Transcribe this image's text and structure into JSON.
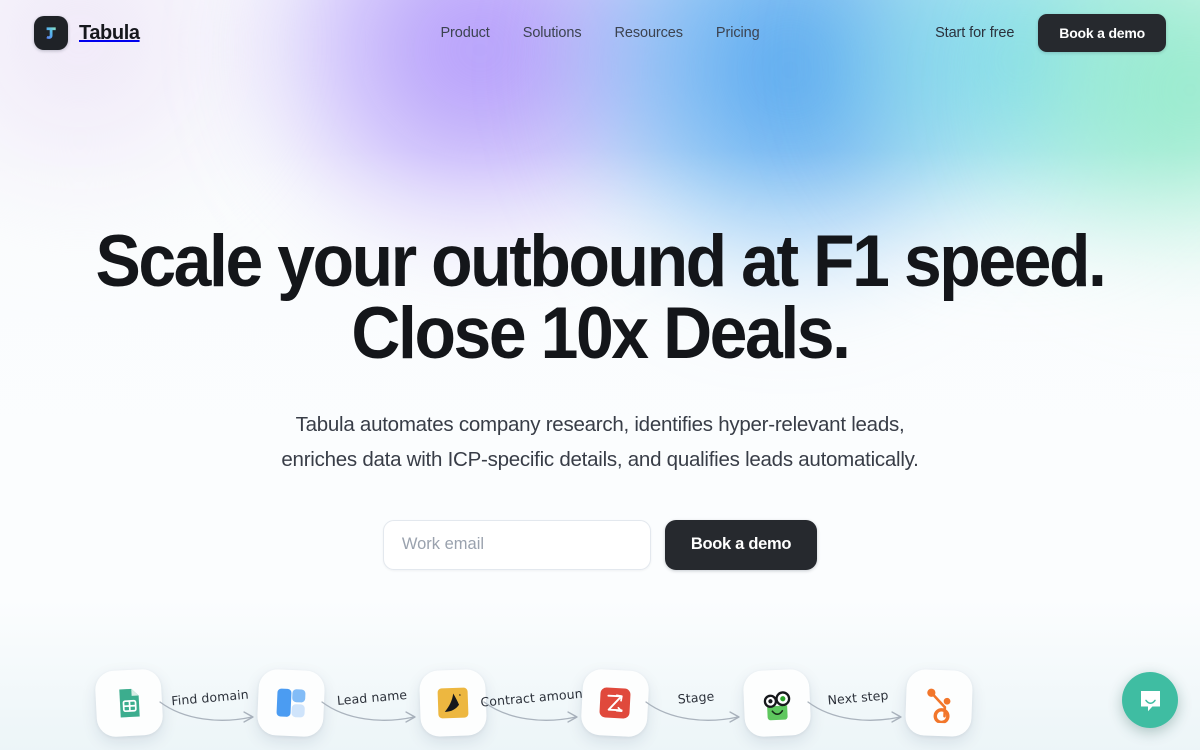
{
  "brand": {
    "name": "Tabula",
    "logo_icon": "tabula-logo-icon"
  },
  "nav": {
    "items": [
      {
        "label": "Product"
      },
      {
        "label": "Solutions"
      },
      {
        "label": "Resources"
      },
      {
        "label": "Pricing"
      }
    ],
    "start_free_label": "Start for free",
    "demo_button_label": "Book a demo"
  },
  "hero": {
    "headline_line1": "Scale your outbound at F1 speed.",
    "headline_line2": "Close 10x Deals.",
    "subhead_line1": "Tabula automates company research, identifies hyper-relevant leads,",
    "subhead_line2": "enriches data with ICP-specific details, and qualifies leads automatically.",
    "email_placeholder": "Work email",
    "email_value": "",
    "demo_button_label": "Book a demo"
  },
  "flow": {
    "apps": [
      {
        "name": "google-sheets",
        "icon": "google-sheets-icon"
      },
      {
        "name": "clearbit",
        "icon": "clearbit-icon"
      },
      {
        "name": "apollo",
        "icon": "apollo-icon"
      },
      {
        "name": "zoominfo",
        "icon": "zoominfo-icon"
      },
      {
        "name": "lemlist",
        "icon": "lemlist-frog-icon"
      },
      {
        "name": "hubspot",
        "icon": "hubspot-icon"
      }
    ],
    "connectors": [
      {
        "label": "Find domain"
      },
      {
        "label": "Lead name"
      },
      {
        "label": "Contract amount"
      },
      {
        "label": "Stage"
      },
      {
        "label": "Next step"
      }
    ]
  },
  "widgets": {
    "intercom_label": "Open chat",
    "intercom_icon": "chat-bubble-icon"
  },
  "colors": {
    "dark_button": "#26292e",
    "text_primary": "#14161a",
    "text_secondary": "#383d47",
    "intercom_teal": "#3fbda2",
    "sheets_green": "#3cad8e",
    "clearbit_blue": "#4b9cf2",
    "apollo_yellow": "#edb740",
    "zoominfo_red": "#e0493c",
    "lemlist_green": "#5ec75e",
    "hubspot_orange": "#f2762b"
  }
}
